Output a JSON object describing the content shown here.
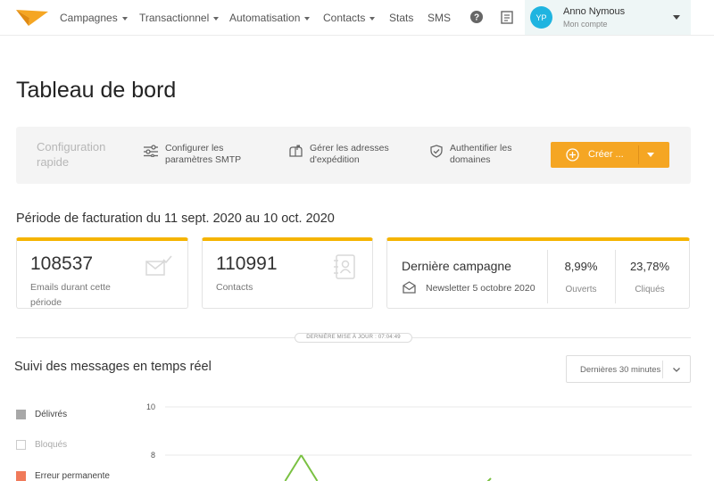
{
  "nav": {
    "items": [
      {
        "label": "Campagnes",
        "dropdown": true
      },
      {
        "label": "Transactionnel",
        "dropdown": true
      },
      {
        "label": "Automatisation",
        "dropdown": true
      },
      {
        "label": "Contacts",
        "dropdown": true
      },
      {
        "label": "Stats",
        "dropdown": false
      },
      {
        "label": "SMS",
        "dropdown": false
      }
    ],
    "help_icon": "help-circle-icon",
    "doc_icon": "document-icon"
  },
  "account": {
    "initials": "YP",
    "name": "Anno Nymous",
    "subtitle": "Mon compte"
  },
  "page_title": "Tableau de bord",
  "quick_config": {
    "label": "Configuration rapide",
    "links": [
      {
        "label": "Configurer les paramètres SMTP",
        "icon": "sliders-icon"
      },
      {
        "label": "Gérer les adresses d'expédition",
        "icon": "mailbox-icon"
      },
      {
        "label": "Authentifier les domaines",
        "icon": "shield-check-icon"
      }
    ],
    "create_label": "Créer ..."
  },
  "billing_period": "Période de facturation du 11 sept. 2020 au 10 oct. 2020",
  "cards": {
    "emails": {
      "value": "108537",
      "label": "Emails durant cette période",
      "icon": "envelope-check-icon"
    },
    "contacts": {
      "value": "110991",
      "label": "Contacts",
      "icon": "contact-book-icon"
    },
    "campaign": {
      "title": "Dernière campagne",
      "name": "Newsletter 5 octobre 2020",
      "opened_value": "8,99%",
      "opened_label": "Ouverts",
      "clicked_value": "23,78%",
      "clicked_label": "Cliqués"
    }
  },
  "last_update": "DERNIÈRE MISE À JOUR : 07:04:49",
  "realtime": {
    "title": "Suivi des messages en temps réel",
    "range_selected": "Dernières 30 minutes",
    "legend": [
      {
        "label": "Délivrés",
        "color": "#a8a8a8",
        "active": true
      },
      {
        "label": "Bloqués",
        "color": "#ffffff",
        "active": false
      },
      {
        "label": "Erreur permanente",
        "color": "#f07a5a",
        "active": true
      }
    ]
  },
  "chart_data": {
    "type": "line",
    "y_ticks": [
      "10",
      "8"
    ],
    "series": [
      {
        "color": "#7ac142",
        "values": [
          null,
          null,
          8,
          null,
          null,
          null,
          null,
          null,
          null
        ]
      }
    ]
  },
  "colors": {
    "accent": "#f5a623",
    "card_border_top": "#f5b400",
    "avatar": "#1fb4e0",
    "chart_line": "#7ac142"
  }
}
